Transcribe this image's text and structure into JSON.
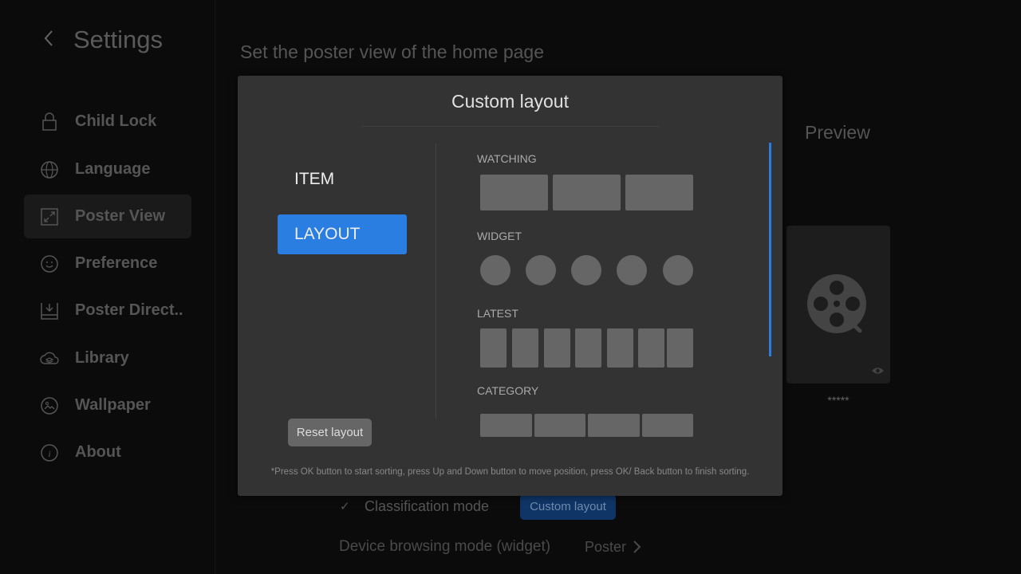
{
  "header": {
    "title": "Settings",
    "back_icon": "chevron-left-icon"
  },
  "sidebar": {
    "items": [
      {
        "label": "Child Lock",
        "icon": "lock-icon"
      },
      {
        "label": "Language",
        "icon": "globe-icon"
      },
      {
        "label": "Poster View",
        "icon": "expand-icon",
        "selected": true
      },
      {
        "label": "Preference",
        "icon": "smiley-icon"
      },
      {
        "label": "Poster Direct..",
        "icon": "download-tray-icon"
      },
      {
        "label": "Library",
        "icon": "cloud-layers-icon"
      },
      {
        "label": "Wallpaper",
        "icon": "image-icon"
      },
      {
        "label": "About",
        "icon": "info-icon"
      }
    ]
  },
  "main": {
    "subtitle": "Set the poster view of the home page",
    "preview_label": "Preview",
    "poster_rating": "*****",
    "classification_mode": "Classification mode",
    "custom_layout_button": "Custom layout",
    "device_browsing_label": "Device browsing mode (widget)",
    "device_browsing_value": "Poster"
  },
  "modal": {
    "title": "Custom layout",
    "tabs": [
      {
        "label": "ITEM"
      },
      {
        "label": "LAYOUT",
        "active": true
      }
    ],
    "sections": [
      "WATCHING",
      "WIDGET",
      "LATEST",
      "CATEGORY"
    ],
    "reset_label": "Reset layout",
    "hint": "*Press OK button to start sorting, press Up and Down button to move position, press OK/ Back button to finish sorting.",
    "accent": "#2a7de1"
  }
}
